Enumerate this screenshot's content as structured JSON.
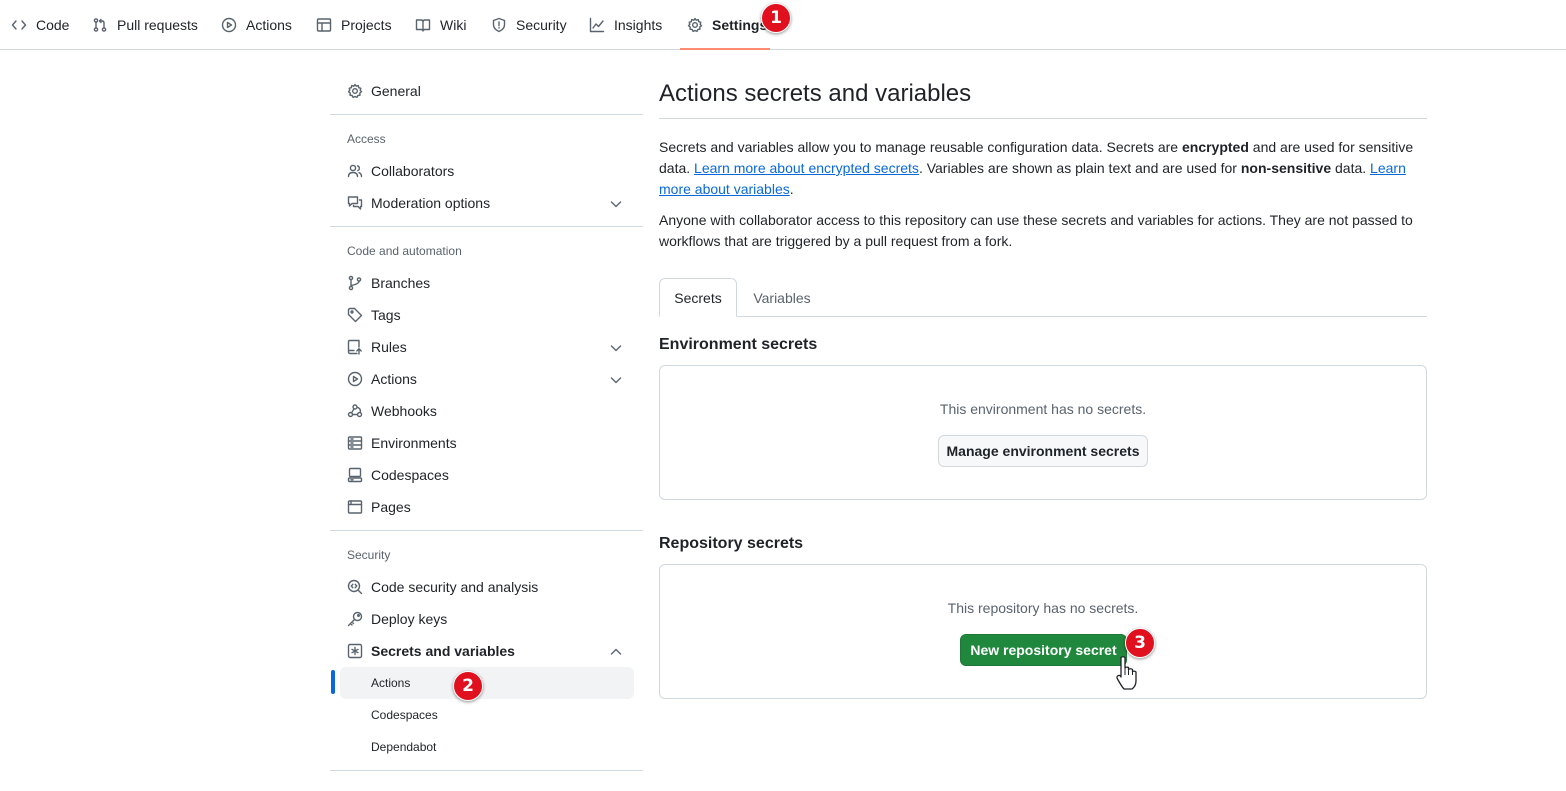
{
  "colors": {
    "accent_underline": "#fd8c73",
    "link": "#0969da",
    "primary_button": "#1f883d",
    "active_bar": "#0969da",
    "badge": "#e0101f"
  },
  "repo_nav": {
    "tabs": [
      {
        "label": "Code",
        "icon": "code-icon"
      },
      {
        "label": "Pull requests",
        "icon": "pull-request-icon"
      },
      {
        "label": "Actions",
        "icon": "play-icon"
      },
      {
        "label": "Projects",
        "icon": "table-icon"
      },
      {
        "label": "Wiki",
        "icon": "book-icon"
      },
      {
        "label": "Security",
        "icon": "shield-icon"
      },
      {
        "label": "Insights",
        "icon": "graph-icon"
      },
      {
        "label": "Settings",
        "icon": "gear-icon",
        "selected": true
      }
    ]
  },
  "annotations": {
    "step1": "1",
    "step2": "2",
    "step3": "3"
  },
  "sidebar": {
    "general": "General",
    "access_heading": "Access",
    "collaborators": "Collaborators",
    "moderation": "Moderation options",
    "code_heading": "Code and automation",
    "branches": "Branches",
    "tags": "Tags",
    "rules": "Rules",
    "actions": "Actions",
    "webhooks": "Webhooks",
    "environments": "Environments",
    "codespaces": "Codespaces",
    "pages": "Pages",
    "security_heading": "Security",
    "code_security": "Code security and analysis",
    "deploy_keys": "Deploy keys",
    "secrets_variables": "Secrets and variables",
    "sub_actions": "Actions",
    "sub_codespaces": "Codespaces",
    "sub_dependabot": "Dependabot"
  },
  "main": {
    "title": "Actions secrets and variables",
    "intro": {
      "t1": "Secrets and variables allow you to manage reusable configuration data. Secrets are ",
      "b1": "encrypted",
      "t2": " and are used for sensitive data. ",
      "link1": "Learn more about encrypted secrets",
      "t3": ". Variables are shown as plain text and are used for ",
      "b2": "non-sensitive",
      "t4": " data. ",
      "link2": "Learn more about variables",
      "t5": "."
    },
    "access_note": "Anyone with collaborator access to this repository can use these secrets and variables for actions. They are not passed to workflows that are triggered by a pull request from a fork.",
    "tabs": {
      "secrets": "Secrets",
      "variables": "Variables"
    },
    "env_heading": "Environment secrets",
    "env_empty": "This environment has no secrets.",
    "env_button": "Manage environment secrets",
    "repo_heading": "Repository secrets",
    "repo_empty": "This repository has no secrets.",
    "repo_button": "New repository secret"
  }
}
